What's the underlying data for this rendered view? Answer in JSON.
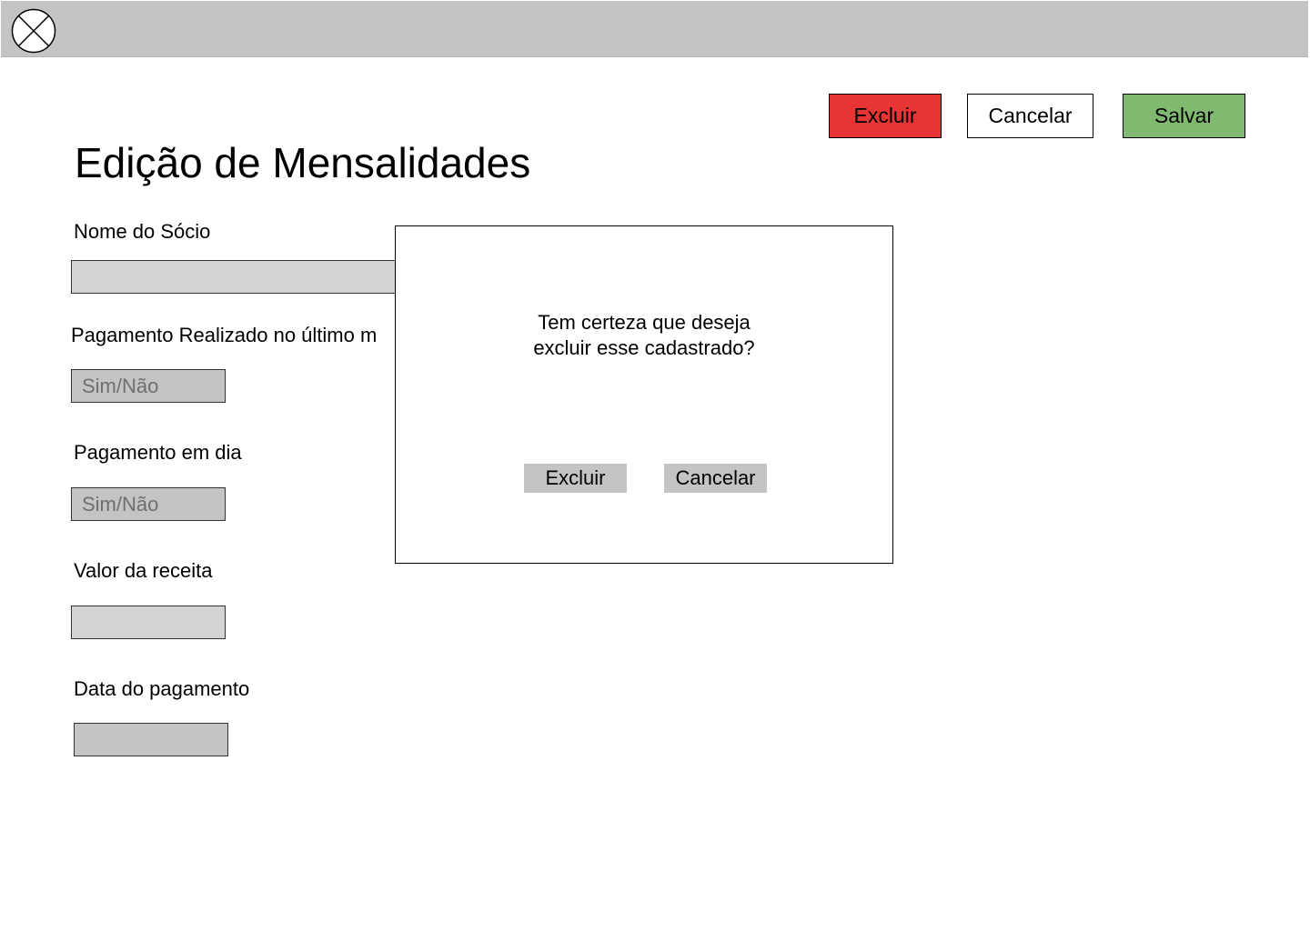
{
  "header": {
    "logo_icon": "circle-x-placeholder-icon"
  },
  "toolbar": {
    "delete_label": "Excluir",
    "cancel_label": "Cancelar",
    "save_label": "Salvar",
    "delete_color": "#e73434",
    "save_color": "#80ba70"
  },
  "page": {
    "title": "Edição de Mensalidades"
  },
  "form": {
    "member_name": {
      "label": "Nome do Sócio",
      "value": ""
    },
    "paid_last_month": {
      "label": "Pagamento Realizado no último m",
      "value": "Sim/Não"
    },
    "payment_up_to_date": {
      "label": "Pagamento em dia",
      "value": "Sim/Não"
    },
    "revenue_amount": {
      "label": "Valor da receita",
      "value": ""
    },
    "payment_date": {
      "label": "Data do pagamento",
      "value": ""
    }
  },
  "dialog": {
    "message_line1": "Tem certeza que deseja",
    "message_line2": "excluir esse cadastrado?",
    "confirm_label": "Excluir",
    "cancel_label": "Cancelar"
  }
}
